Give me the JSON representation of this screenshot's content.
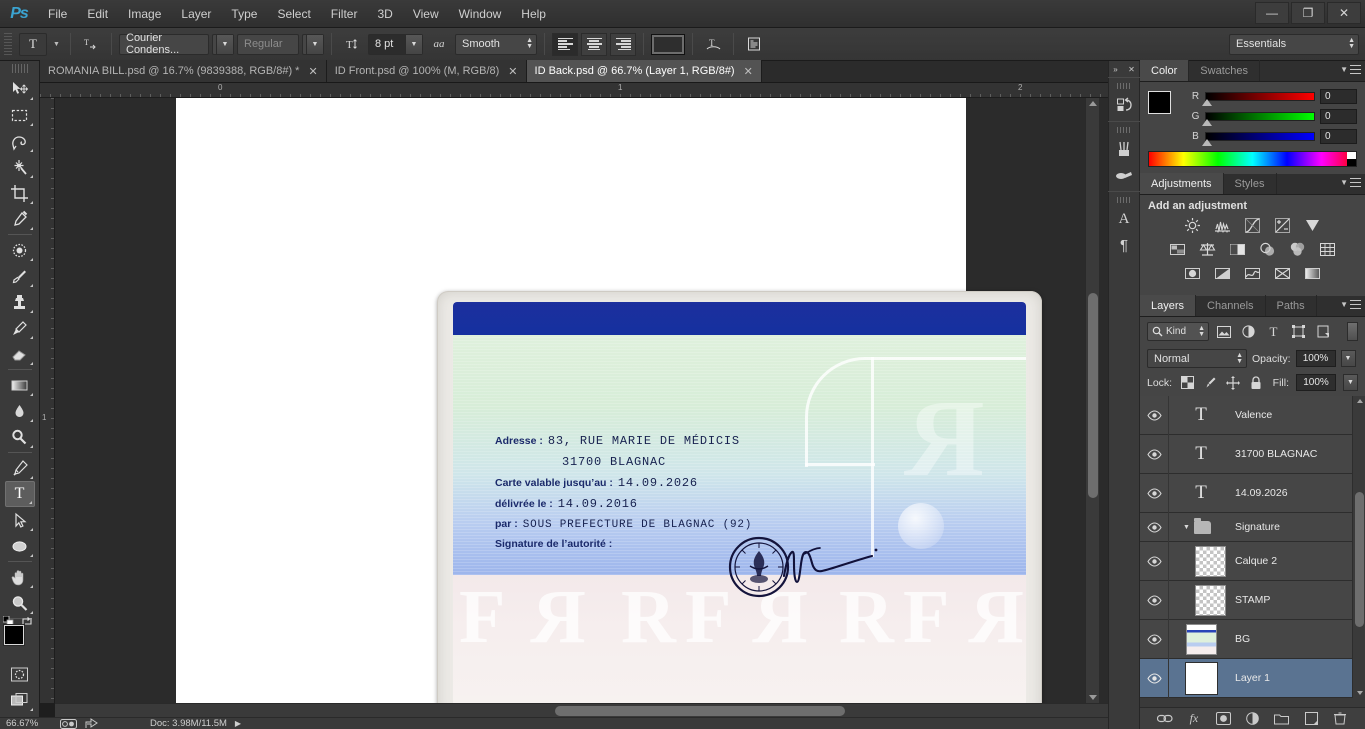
{
  "app": {
    "logo": "Ps",
    "menus": [
      "File",
      "Edit",
      "Image",
      "Layer",
      "Type",
      "Select",
      "Filter",
      "3D",
      "View",
      "Window",
      "Help"
    ],
    "window_buttons": {
      "minimize": "—",
      "restore": "❐",
      "close": "✕"
    }
  },
  "options_bar": {
    "tool_icon": "T",
    "tool_preset_label": "type-tool-preset",
    "orientation_icon": "toggle-text-orientation",
    "font_family": "Courier Condens...",
    "font_style": "Regular",
    "font_size": "8 pt",
    "anti_alias_icon": "aa",
    "anti_alias": "Smooth",
    "align": [
      "left",
      "center",
      "right"
    ],
    "align_active": "left",
    "color_swatch": "#2e2e2e",
    "warp_icon": "warp-text",
    "panels_icon": "toggle-character-panels",
    "workspace": "Essentials"
  },
  "tabs": [
    {
      "label": "ROMANIA BILL.psd @ 16.7% (9839388, RGB/8#) *",
      "active": false,
      "close": "✕"
    },
    {
      "label": "ID Front.psd @ 100% (M, RGB/8)",
      "active": false,
      "close": "✕"
    },
    {
      "label": "ID Back.psd @ 66.7% (Layer 1, RGB/8#)",
      "active": true,
      "close": "✕"
    }
  ],
  "rulers": {
    "horizontal_labels": [
      "0",
      "1",
      "2"
    ],
    "vertical_labels": [
      "1"
    ],
    "unit": "inches"
  },
  "toolbar": [
    {
      "name": "move-tool",
      "glyph": "move"
    },
    {
      "name": "rectangular-marquee-tool",
      "glyph": "marquee"
    },
    {
      "name": "lasso-tool",
      "glyph": "lasso"
    },
    {
      "name": "magic-wand-tool",
      "glyph": "wand"
    },
    {
      "name": "crop-tool",
      "glyph": "crop"
    },
    {
      "name": "eyedropper-tool",
      "glyph": "eyedropper"
    },
    {
      "name": "spot-healing-brush-tool",
      "glyph": "healing"
    },
    {
      "name": "brush-tool",
      "glyph": "brush"
    },
    {
      "name": "clone-stamp-tool",
      "glyph": "stamp"
    },
    {
      "name": "history-brush-tool",
      "glyph": "history"
    },
    {
      "name": "eraser-tool",
      "glyph": "eraser"
    },
    {
      "name": "gradient-tool",
      "glyph": "gradient"
    },
    {
      "name": "blur-tool",
      "glyph": "blur"
    },
    {
      "name": "dodge-tool",
      "glyph": "dodge"
    },
    {
      "name": "pen-tool",
      "glyph": "pen"
    },
    {
      "name": "type-tool",
      "glyph": "T",
      "selected": true
    },
    {
      "name": "path-selection-tool",
      "glyph": "arrow"
    },
    {
      "name": "ellipse-tool",
      "glyph": "ellipse"
    },
    {
      "name": "hand-tool",
      "glyph": "hand"
    },
    {
      "name": "zoom-tool",
      "glyph": "zoom"
    }
  ],
  "toolbar_footer": {
    "foreground_color": "#000000",
    "background_color": "#ffffff",
    "quick_mask_icon": "quick-mask",
    "screen_mode_icon": "screen-mode"
  },
  "document": {
    "card": {
      "band_color": "#15309f",
      "body_gradient_top": "#dff0dc",
      "body_gradient_bottom": "#9db5ec",
      "bottom_color": "#f5eeee",
      "watermark": "RF",
      "fields": [
        {
          "label": "Adresse :",
          "value": "83, RUE MARIE DE MÉDICIS"
        },
        {
          "label": "",
          "value": "31700 BLAGNAC",
          "indent": true
        },
        {
          "label": "Carte valable jusqu’au :",
          "value": "14.09.2026"
        },
        {
          "label": "délivrée le :",
          "value": "14.09.2016"
        },
        {
          "label": "par :",
          "value": "SOUS PREFECTURE DE BLAGNAC (92)"
        },
        {
          "label": "Signature de l’autorité :",
          "value": ""
        }
      ],
      "stamp_name": "official-round-stamp",
      "signature_name": "handwritten-signature"
    }
  },
  "status_bar": {
    "zoom": "66.67%",
    "doc_info": "Doc: 3.98M/11.5M",
    "arrow": "▶"
  },
  "icon_dock": [
    {
      "name": "history-icon",
      "glyph": "history"
    },
    {
      "name": "brush-presets-icon",
      "glyph": "brush"
    },
    {
      "name": "clone-source-icon",
      "glyph": "clone"
    },
    {
      "name": "character-icon",
      "glyph": "A"
    },
    {
      "name": "paragraph-icon",
      "glyph": "¶"
    }
  ],
  "color_panel": {
    "tabs": [
      {
        "label": "Color",
        "active": true
      },
      {
        "label": "Swatches",
        "active": false
      }
    ],
    "foreground": "#000000",
    "background": "#ffffff",
    "channels": [
      {
        "name": "R",
        "value": "0"
      },
      {
        "name": "G",
        "value": "0"
      },
      {
        "name": "B",
        "value": "0"
      }
    ]
  },
  "adjustments_panel": {
    "tabs": [
      {
        "label": "Adjustments",
        "active": true
      },
      {
        "label": "Styles",
        "active": false
      }
    ],
    "title": "Add an adjustment",
    "rows": [
      [
        "brightness-contrast",
        "levels",
        "curves",
        "exposure",
        "vibrance"
      ],
      [
        "hue-saturation",
        "color-balance",
        "black-white",
        "photo-filter",
        "channel-mixer",
        "color-lookup"
      ],
      [
        "invert",
        "posterize",
        "threshold",
        "selective-color",
        "gradient-map"
      ]
    ]
  },
  "layers_panel": {
    "tabs": [
      {
        "label": "Layers",
        "active": true
      },
      {
        "label": "Channels",
        "active": false
      },
      {
        "label": "Paths",
        "active": false
      }
    ],
    "filter_kind": "Kind",
    "filter_icons": [
      "pixel-layers",
      "adjustment-layers",
      "type-layers",
      "shape-layers",
      "smart-objects"
    ],
    "blend_mode": "Normal",
    "opacity_label": "Opacity:",
    "opacity_value": "100%",
    "lock_label": "Lock:",
    "lock_icons": [
      "lock-transparent-pixels",
      "lock-image-pixels",
      "lock-position",
      "lock-all"
    ],
    "fill_label": "Fill:",
    "fill_value": "100%",
    "layers": [
      {
        "name": "Valence",
        "type": "text",
        "visible": true,
        "selected": false
      },
      {
        "name": "31700 BLAGNAC",
        "type": "text",
        "visible": true,
        "selected": false
      },
      {
        "name": "14.09.2026",
        "type": "text",
        "visible": true,
        "selected": false
      },
      {
        "name": "Signature",
        "type": "group",
        "visible": true,
        "selected": false,
        "expanded": true
      },
      {
        "name": "Calque 2",
        "type": "transparent",
        "visible": true,
        "selected": false
      },
      {
        "name": "STAMP",
        "type": "transparent",
        "visible": true,
        "selected": false
      },
      {
        "name": "BG",
        "type": "image",
        "visible": true,
        "selected": false
      },
      {
        "name": "Layer 1",
        "type": "white",
        "visible": true,
        "selected": true
      }
    ],
    "footer_icons": [
      "link-layers",
      "add-layer-style",
      "add-layer-mask",
      "new-fill-adjustment",
      "new-group",
      "new-layer",
      "delete-layer"
    ]
  }
}
